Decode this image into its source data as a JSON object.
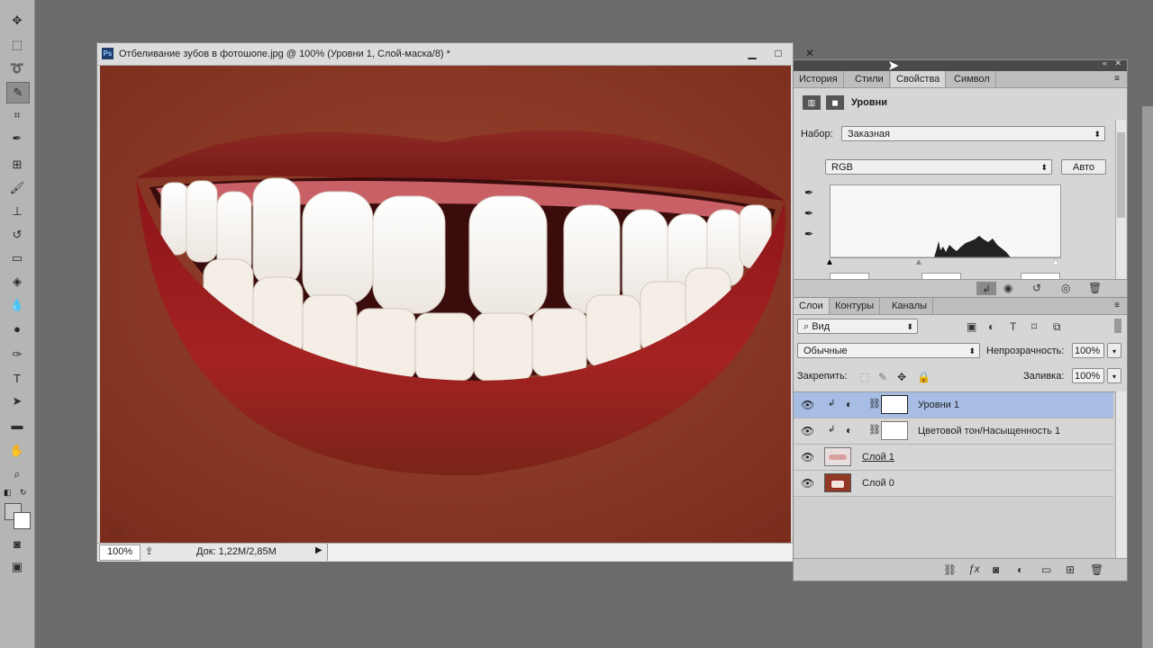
{
  "document": {
    "title": "Отбеливание зубов в фотошопе.jpg @ 100% (Уровни 1, Слой-маска/8) *",
    "ps_badge": "Ps",
    "minimize": "▁",
    "maximize": "□",
    "close": "✕",
    "watermark": "cps",
    "zoom": "100%",
    "doc_info": "Док: 1,22M/2,85M"
  },
  "properties_panel": {
    "tabs": [
      "История",
      "Стили",
      "Свойства",
      "Символ"
    ],
    "active_tab": "Свойства",
    "header_title": "Уровни",
    "preset_label": "Набор:",
    "preset_value": "Заказная",
    "channel_value": "RGB",
    "auto_button": "Авто"
  },
  "layers_panel": {
    "tabs": [
      "Слои",
      "Контуры",
      "Каналы"
    ],
    "active_tab": "Слои",
    "filter_kind": "Вид",
    "blend_mode": "Обычные",
    "opacity_label": "Непрозрачность:",
    "opacity_value": "100%",
    "lock_label": "Закрепить:",
    "fill_label": "Заливка:",
    "fill_value": "100%",
    "layers": [
      {
        "name": "Уровни 1",
        "selected": true,
        "type": "adjustment"
      },
      {
        "name": "Цветовой тон/Насыщенность 1",
        "selected": false,
        "type": "adjustment"
      },
      {
        "name": "Слой 1",
        "selected": false,
        "type": "pixel"
      },
      {
        "name": "Слой 0",
        "selected": false,
        "type": "pixel"
      }
    ]
  },
  "colors": {
    "background": "#6b6b6b",
    "panel": "#d6d6d6",
    "selection": "#a7bde4",
    "lip_red": "#8a1a1a",
    "skin": "#8e3a26"
  }
}
